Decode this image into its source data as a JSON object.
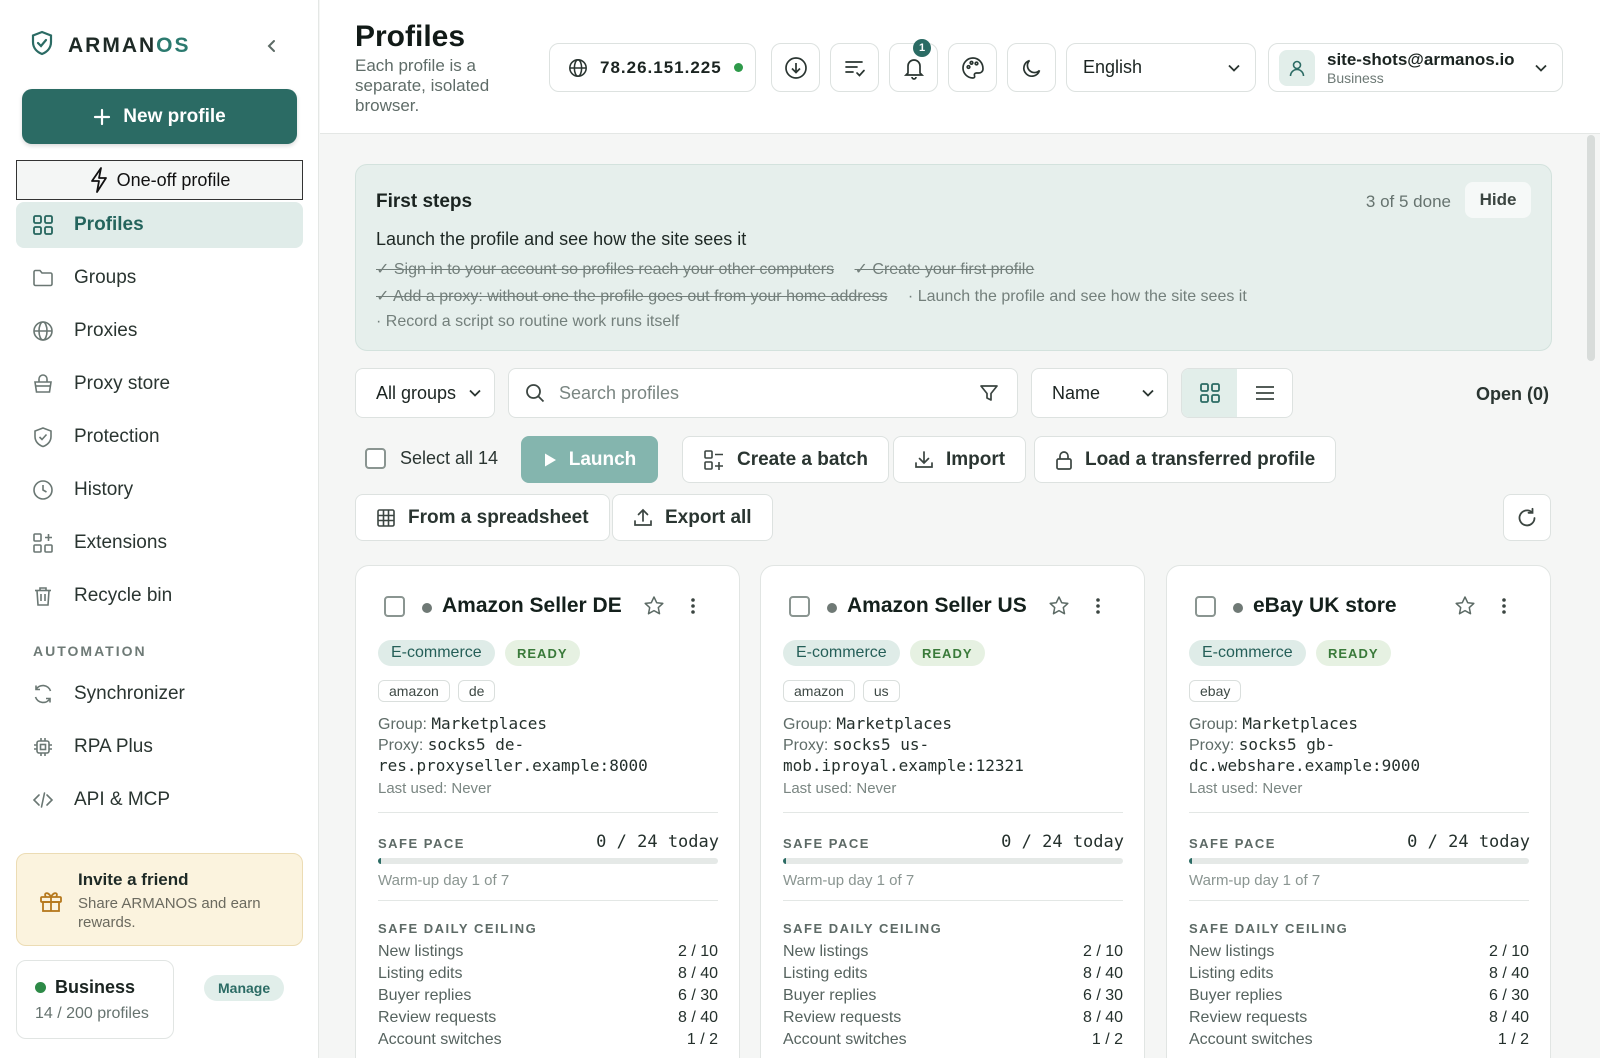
{
  "brand": {
    "name_main": "ARMAN",
    "name_accent": "OS"
  },
  "sidebar": {
    "new_profile": "New profile",
    "one_off": "One-off profile",
    "items": [
      {
        "label": "Profiles",
        "icon": "grid-icon"
      },
      {
        "label": "Groups",
        "icon": "folder-icon"
      },
      {
        "label": "Proxies",
        "icon": "globe-icon"
      },
      {
        "label": "Proxy store",
        "icon": "basket-icon"
      },
      {
        "label": "Protection",
        "icon": "shield-icon"
      },
      {
        "label": "History",
        "icon": "clock-icon"
      },
      {
        "label": "Extensions",
        "icon": "extensions-icon"
      },
      {
        "label": "Recycle bin",
        "icon": "trash-icon"
      }
    ],
    "automation_label": "AUTOMATION",
    "automation_items": [
      {
        "label": "Synchronizer",
        "icon": "sync-icon"
      },
      {
        "label": "RPA Plus",
        "icon": "chip-icon"
      },
      {
        "label": "API & MCP",
        "icon": "code-icon"
      }
    ],
    "invite": {
      "title": "Invite a friend",
      "subtitle": "Share ARMANOS and earn rewards."
    },
    "plan": {
      "name": "Business",
      "count": "14 / 200 profiles",
      "manage": "Manage"
    }
  },
  "header": {
    "title": "Profiles",
    "subtitle": "Each profile is a separate, isolated browser.",
    "ip": "78.26.151.225",
    "notifications": "1",
    "language": "English",
    "account_email": "site-shots@armanos.io",
    "account_plan": "Business"
  },
  "first_steps": {
    "title": "First steps",
    "progress": "3 of 5 done",
    "hide": "Hide",
    "current": "Launch the profile and see how the site sees it",
    "done": [
      "✓ Sign in to your account so profiles reach your other computers",
      "✓ Create your first profile",
      "✓ Add a proxy: without one the profile goes out from your home address"
    ],
    "todo": [
      "· Launch the profile and see how the site sees it",
      "· Record a script so routine work runs itself"
    ]
  },
  "toolbar": {
    "groups": "All groups",
    "search_placeholder": "Search profiles",
    "sort": "Name",
    "open": "Open (0)",
    "select_all": "Select all 14",
    "launch": "Launch",
    "batch": "Create a batch",
    "import": "Import",
    "transfer": "Load a transferred profile",
    "spreadsheet": "From a spreadsheet",
    "export": "Export all"
  },
  "cards": [
    {
      "title": "Amazon Seller DE",
      "category": "E-commerce",
      "status": "READY",
      "tags": [
        "amazon",
        "de"
      ],
      "group_label": "Group:",
      "group": "Marketplaces",
      "proxy_label": "Proxy:",
      "proxy": "socks5 de-res.proxyseller.example:8000",
      "last_used": "Last used: Never",
      "pace_label": "SAFE PACE",
      "pace": "0 / 24 today",
      "pace_fraction": 0.01,
      "warmup": "Warm-up day 1 of 7",
      "ceiling_label": "SAFE DAILY CEILING",
      "ceiling": [
        {
          "k": "New listings",
          "v": "2 / 10"
        },
        {
          "k": "Listing edits",
          "v": "8 / 40"
        },
        {
          "k": "Buyer replies",
          "v": "6 / 30"
        },
        {
          "k": "Review requests",
          "v": "8 / 40"
        },
        {
          "k": "Account switches",
          "v": "1 / 2"
        }
      ]
    },
    {
      "title": "Amazon Seller US",
      "category": "E-commerce",
      "status": "READY",
      "tags": [
        "amazon",
        "us"
      ],
      "group_label": "Group:",
      "group": "Marketplaces",
      "proxy_label": "Proxy:",
      "proxy": "socks5 us-mob.iproyal.example:12321",
      "last_used": "Last used: Never",
      "pace_label": "SAFE PACE",
      "pace": "0 / 24 today",
      "pace_fraction": 0.01,
      "warmup": "Warm-up day 1 of 7",
      "ceiling_label": "SAFE DAILY CEILING",
      "ceiling": [
        {
          "k": "New listings",
          "v": "2 / 10"
        },
        {
          "k": "Listing edits",
          "v": "8 / 40"
        },
        {
          "k": "Buyer replies",
          "v": "6 / 30"
        },
        {
          "k": "Review requests",
          "v": "8 / 40"
        },
        {
          "k": "Account switches",
          "v": "1 / 2"
        }
      ]
    },
    {
      "title": "eBay UK store",
      "category": "E-commerce",
      "status": "READY",
      "tags": [
        "ebay"
      ],
      "group_label": "Group:",
      "group": "Marketplaces",
      "proxy_label": "Proxy:",
      "proxy": "socks5 gb-dc.webshare.example:9000",
      "last_used": "Last used: Never",
      "pace_label": "SAFE PACE",
      "pace": "0 / 24 today",
      "pace_fraction": 0.01,
      "warmup": "Warm-up day 1 of 7",
      "ceiling_label": "SAFE DAILY CEILING",
      "ceiling": [
        {
          "k": "New listings",
          "v": "2 / 10"
        },
        {
          "k": "Listing edits",
          "v": "8 / 40"
        },
        {
          "k": "Buyer replies",
          "v": "6 / 30"
        },
        {
          "k": "Review requests",
          "v": "8 / 40"
        },
        {
          "k": "Account switches",
          "v": "1 / 2"
        }
      ]
    }
  ]
}
